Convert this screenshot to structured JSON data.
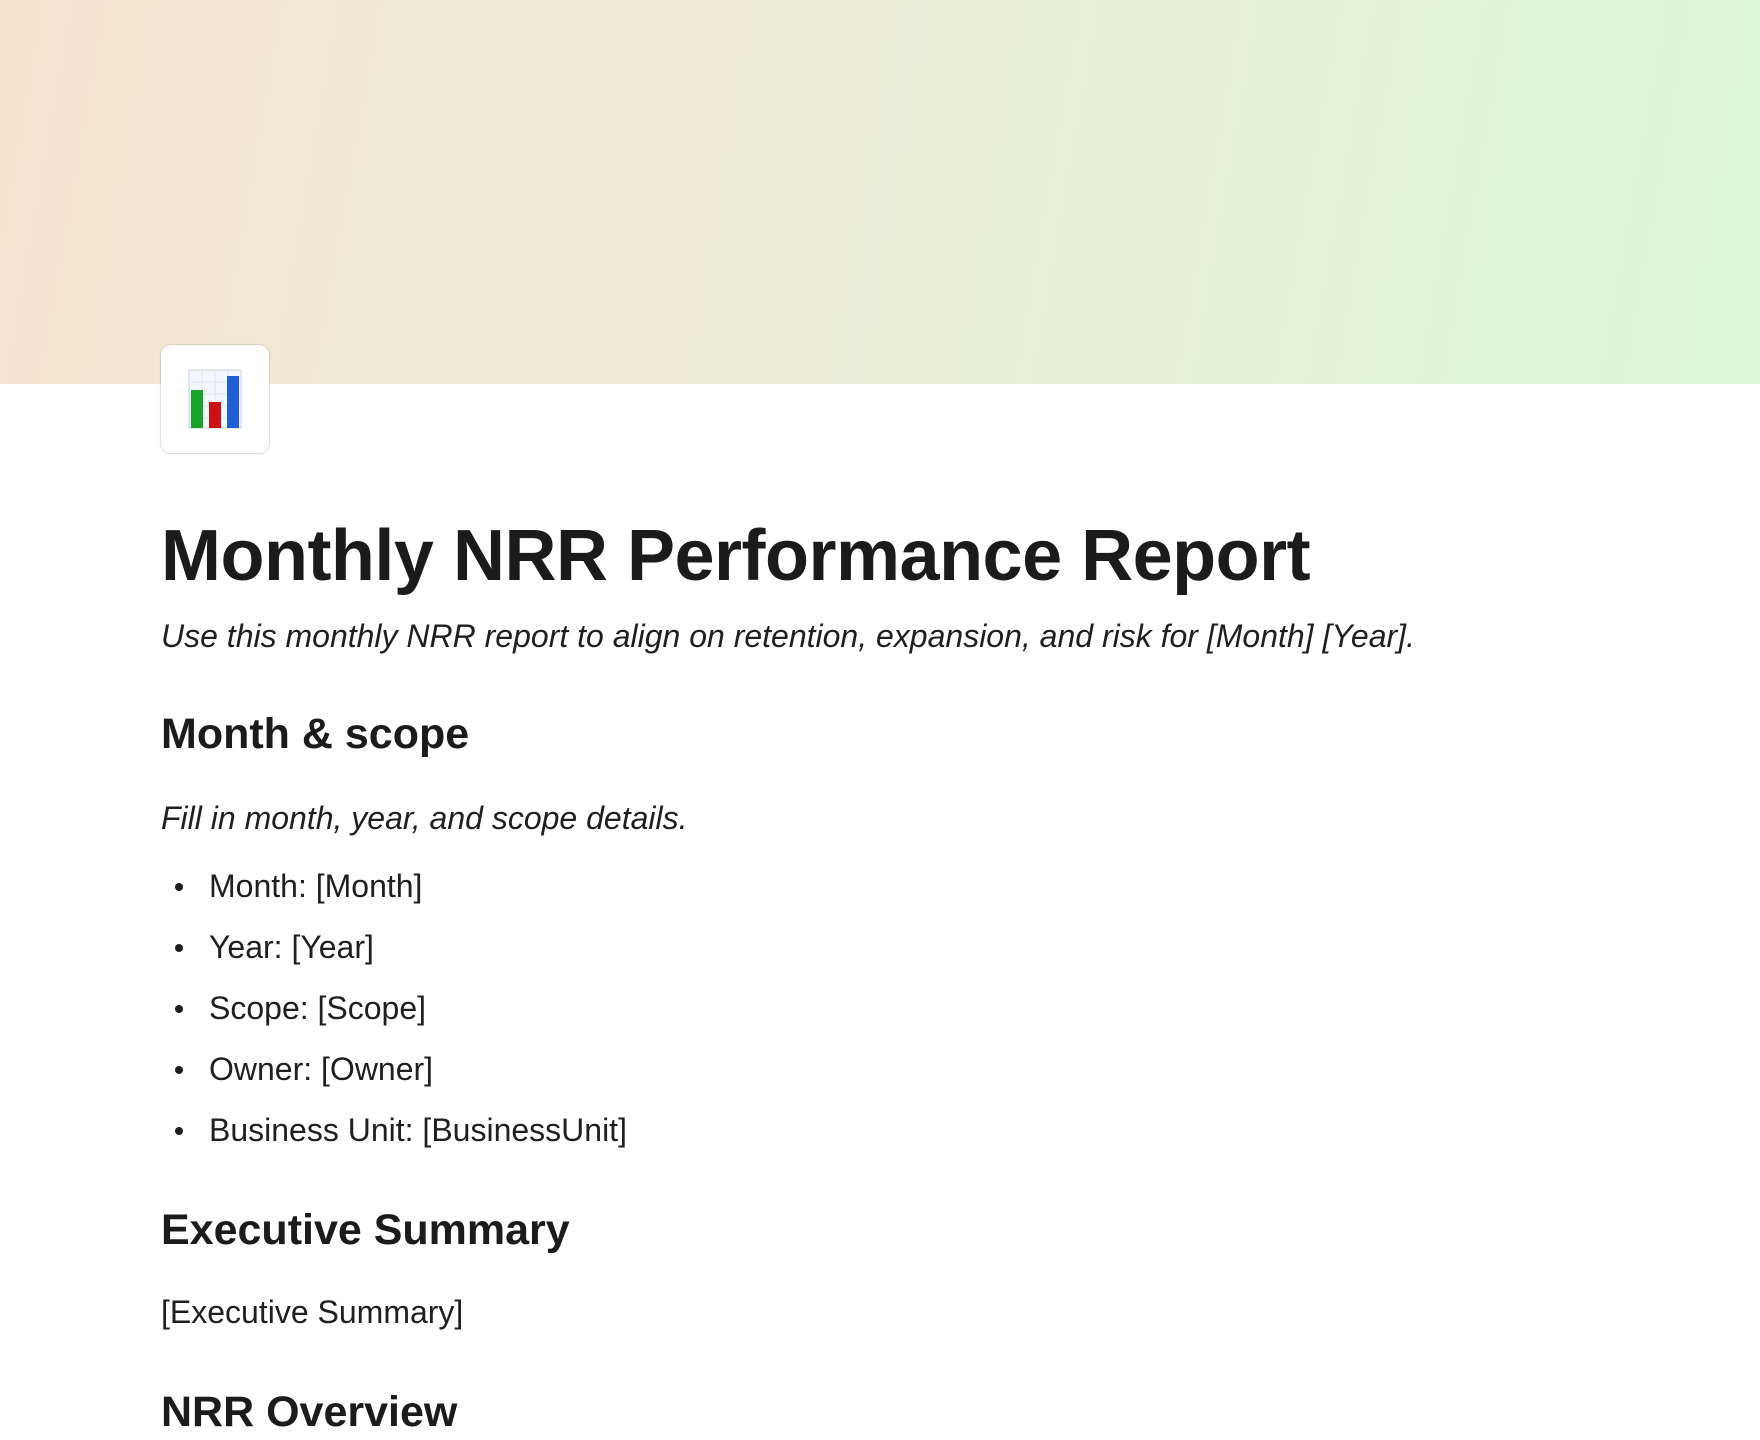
{
  "cover": {
    "gradient_start": "#f6e4cf",
    "gradient_end": "#dbfad6"
  },
  "page_icon": {
    "name": "bar-chart-icon",
    "colors": [
      "#1aa32a",
      "#cc1111",
      "#1f5fd6"
    ]
  },
  "document": {
    "title": "Monthly NRR Performance Report",
    "subtitle": "Use this monthly NRR report to align on retention, expansion, and risk for [Month] [Year].",
    "sections": [
      {
        "heading": "Month & scope",
        "description": "Fill in month, year, and scope details.",
        "items": [
          "Month: [Month]",
          "Year: [Year]",
          "Scope: [Scope]",
          "Owner: [Owner]",
          "Business Unit: [BusinessUnit]"
        ]
      },
      {
        "heading": "Executive Summary",
        "body": "[Executive Summary]"
      },
      {
        "heading": "NRR Overview"
      }
    ]
  }
}
